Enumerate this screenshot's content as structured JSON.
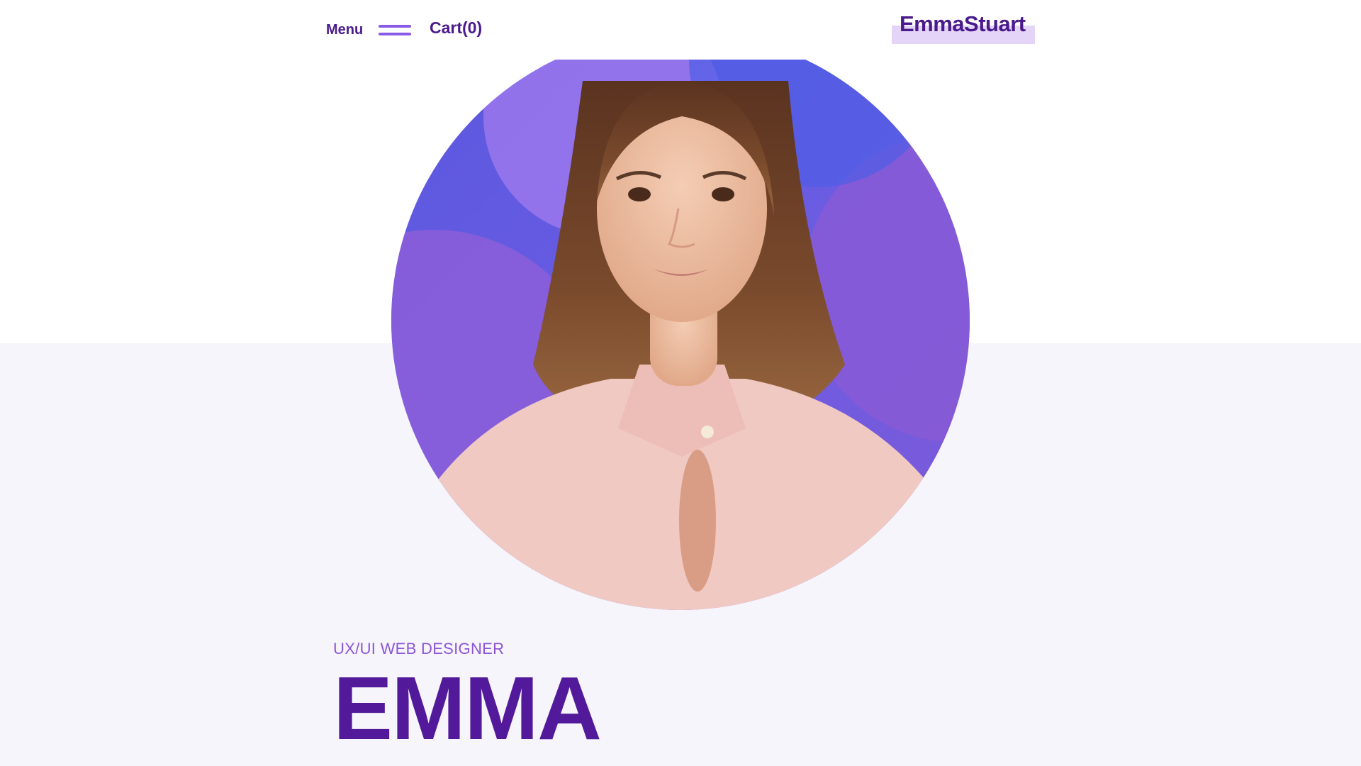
{
  "header": {
    "menu_label": "Menu",
    "cart_label": "Cart(0)",
    "logo_text": "EmmaStuart"
  },
  "hero": {
    "subtitle": "UX/UI WEB DESIGNER",
    "name": "EMMA"
  },
  "colors": {
    "brand_dark": "#4a1a8c",
    "accent": "#8a5ae6",
    "logo_highlight": "#e4d4f8",
    "section_background": "#f5f5fb",
    "portrait_background": "#6a5ce0"
  },
  "icons": {
    "menu": "hamburger-icon"
  }
}
